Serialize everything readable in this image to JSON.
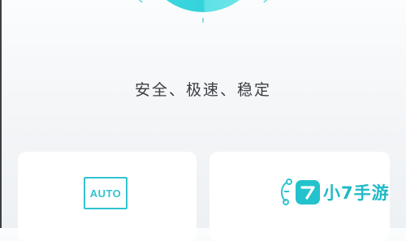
{
  "hero": {
    "slogan": "安全、极速、稳定"
  },
  "cards": [
    {
      "icon": "auto-icon",
      "icon_text": "AUTO"
    },
    {
      "icon": "node-network-icon"
    }
  ],
  "watermark": {
    "icon": "seven-logo-icon",
    "text": "小7手游"
  },
  "colors": {
    "accent": "#32c3cf",
    "dial": "#3cd9df",
    "background": "#f4f6f8",
    "card": "#ffffff",
    "text": "#3a3d42"
  }
}
